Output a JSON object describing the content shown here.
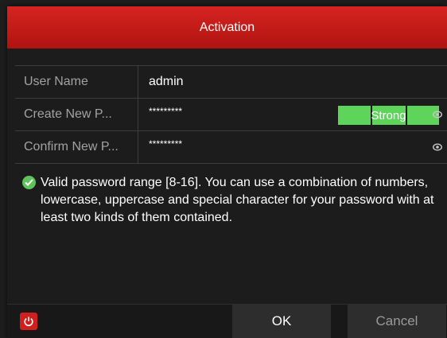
{
  "dialog": {
    "title": "Activation"
  },
  "form": {
    "username": {
      "label": "User Name",
      "value": "admin"
    },
    "new_password": {
      "label": "Create New P...",
      "value": "*********",
      "strength": "Strong"
    },
    "confirm_password": {
      "label": "Confirm New P...",
      "value": "*********"
    }
  },
  "info": {
    "text": "Valid password range [8-16]. You can use a combination of numbers, lowercase, uppercase and special character for your password with at least two kinds of them contained."
  },
  "footer": {
    "ok_label": "OK",
    "cancel_label": "Cancel"
  },
  "icons": {
    "power": "power-icon",
    "check": "check-circle-icon",
    "eye": "eye-icon"
  },
  "colors": {
    "title_bar": "#c41a17",
    "strength_strong": "#5ed45b",
    "check": "#5ec35a",
    "power_button": "#cf1f1f"
  }
}
